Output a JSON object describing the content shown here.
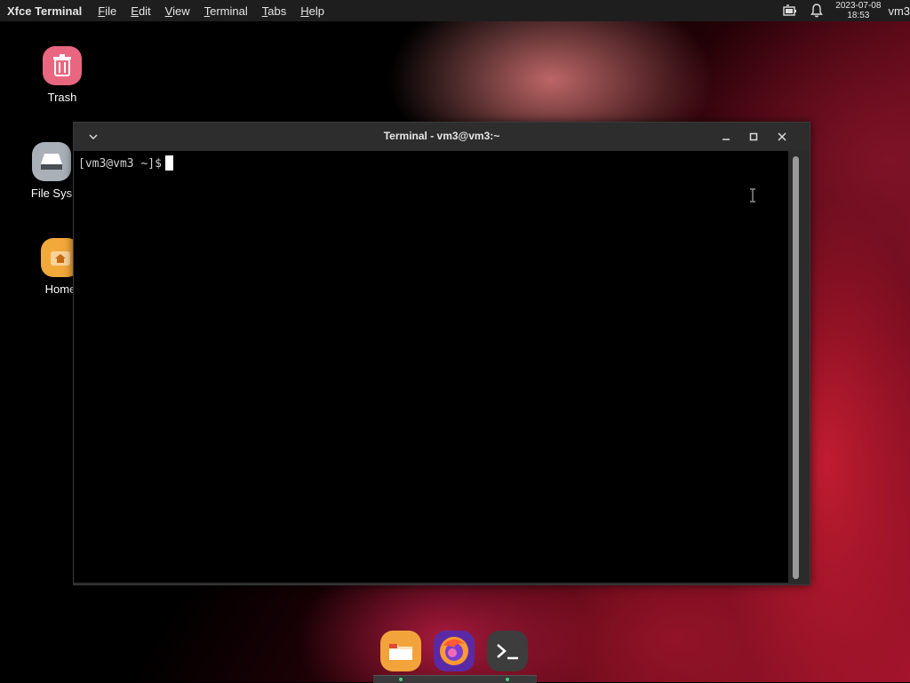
{
  "panel": {
    "app_name": "Xfce Terminal",
    "menu": [
      {
        "label": "File",
        "mnemonic": "F",
        "rest": "ile"
      },
      {
        "label": "Edit",
        "mnemonic": "E",
        "rest": "dit"
      },
      {
        "label": "View",
        "mnemonic": "V",
        "rest": "iew"
      },
      {
        "label": "Terminal",
        "mnemonic": "T",
        "rest": "erminal"
      },
      {
        "label": "Tabs",
        "mnemonic": "T",
        "rest": "abs"
      },
      {
        "label": "Help",
        "mnemonic": "H",
        "rest": "elp"
      }
    ],
    "date": "2023-07-08",
    "time": "18:53",
    "user": "vm3"
  },
  "desktop_icons": [
    {
      "label": "Trash",
      "icon": "trash-icon",
      "color": "#e8667f"
    },
    {
      "label": "File Sys",
      "icon": "drive-icon",
      "color": "#a9b0b8"
    },
    {
      "label": "Home",
      "icon": "home-folder-icon",
      "color": "#f3a83a"
    }
  ],
  "window": {
    "title": "Terminal - vm3@vm3:~",
    "prompt": "[vm3@vm3 ~]$"
  },
  "dock": {
    "items": [
      {
        "name": "files",
        "icon": "folder-icon",
        "color": "#f2a33a"
      },
      {
        "name": "firefox",
        "icon": "firefox-icon",
        "color": "#7a3cc0"
      },
      {
        "name": "terminal",
        "icon": "terminal-icon",
        "color": "#3d3d3d"
      }
    ]
  },
  "colors": {
    "panel_bg": "#1e1e1e",
    "window_bg": "#2d2d2d",
    "terminal_bg": "#000000",
    "accent_dot": "#4cd07d"
  }
}
